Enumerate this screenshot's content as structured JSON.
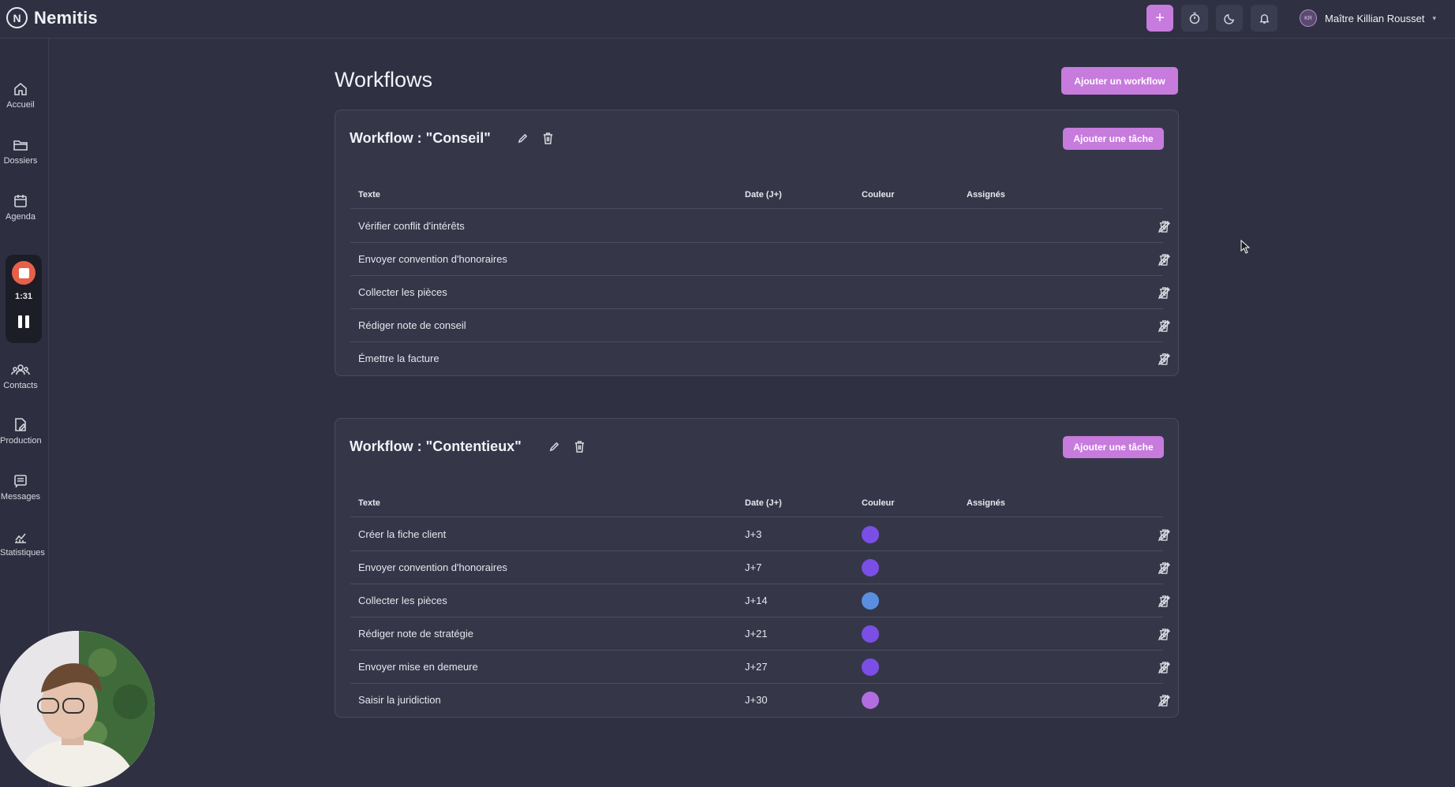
{
  "app": {
    "name": "Nemitis",
    "logo_glyph": "N"
  },
  "header": {
    "user_initials": "KR",
    "user_name": "Maître Killian Rousset",
    "icons": [
      "plus-icon",
      "timer-icon",
      "moon-icon",
      "bell-icon"
    ],
    "accent": "#c77bdd"
  },
  "sidebar": {
    "items": [
      {
        "label": "Accueil",
        "icon": "home-icon"
      },
      {
        "label": "Dossiers",
        "icon": "folder-icon"
      },
      {
        "label": "Agenda",
        "icon": "calendar-icon"
      },
      {
        "label": "Contacts",
        "icon": "contacts-icon"
      },
      {
        "label": "Production",
        "icon": "document-edit-icon"
      },
      {
        "label": "Messages",
        "icon": "message-icon"
      },
      {
        "label": "Statistiques",
        "icon": "chart-icon"
      }
    ]
  },
  "recorder": {
    "time": "1:31"
  },
  "main": {
    "title": "Workflows",
    "add_workflow_label": "Ajouter un workflow",
    "columns": {
      "text": "Texte",
      "date": "Date (J+)",
      "color": "Couleur",
      "assignees": "Assignés"
    },
    "workflows": [
      {
        "title": "Workflow : \"Conseil\"",
        "add_task_label": "Ajouter une tâche",
        "tasks": [
          {
            "text": "Vérifier conflit d'intérêts",
            "date": "",
            "color": ""
          },
          {
            "text": "Envoyer convention d'honoraires",
            "date": "",
            "color": ""
          },
          {
            "text": "Collecter les pièces",
            "date": "",
            "color": ""
          },
          {
            "text": "Rédiger note de conseil",
            "date": "",
            "color": ""
          },
          {
            "text": "Émettre la facture",
            "date": "",
            "color": ""
          }
        ]
      },
      {
        "title": "Workflow : \"Contentieux\"",
        "add_task_label": "Ajouter une tâche",
        "tasks": [
          {
            "text": "Créer la fiche client",
            "date": "J+3",
            "color": "#7b4fe6"
          },
          {
            "text": "Envoyer convention d'honoraires",
            "date": "J+7",
            "color": "#7b4fe6"
          },
          {
            "text": "Collecter les pièces",
            "date": "J+14",
            "color": "#5a8fe0"
          },
          {
            "text": "Rédiger note de stratégie",
            "date": "J+21",
            "color": "#7b4fe6"
          },
          {
            "text": "Envoyer mise en demeure",
            "date": "J+27",
            "color": "#7b4fe6"
          },
          {
            "text": "Saisir la juridiction",
            "date": "J+30",
            "color": "#b26de0"
          }
        ]
      }
    ]
  }
}
